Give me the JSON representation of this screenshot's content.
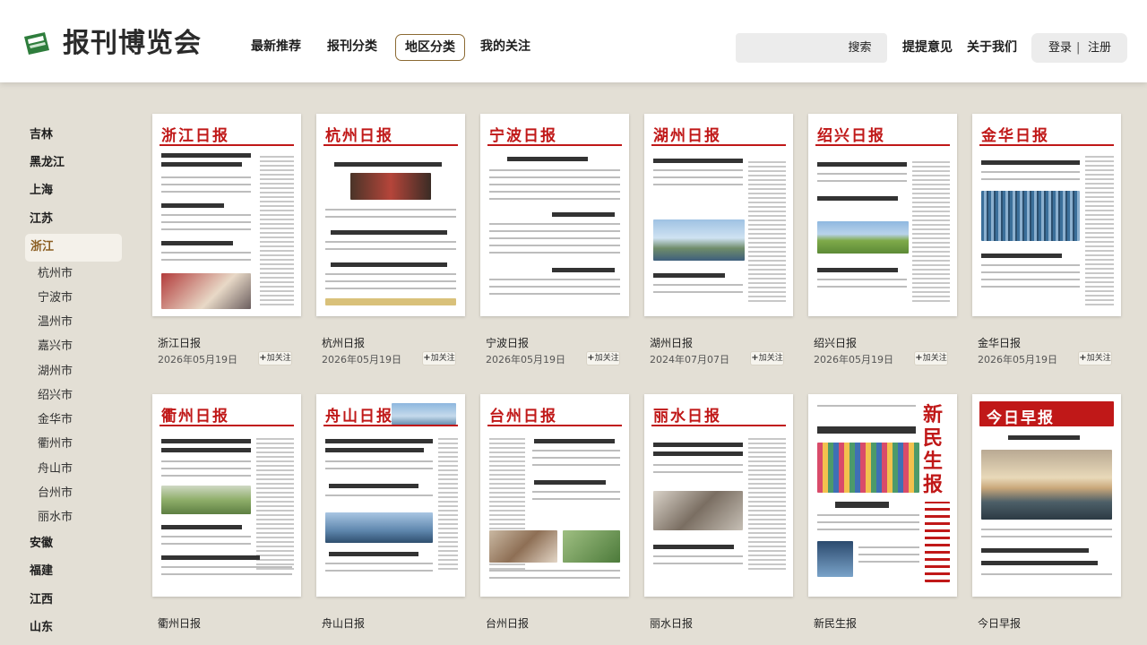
{
  "header": {
    "logo_text": "报刊博览会",
    "nav": [
      "最新推荐",
      "报刊分类",
      "地区分类",
      "我的关注"
    ],
    "search_placeholder": "",
    "search_label": "搜索",
    "feedback_label": "提提意见",
    "about_label": "关于我们",
    "login_label": "登录",
    "auth_separator": "|",
    "register_label": "注册",
    "colors": {
      "accent": "#8b6a33",
      "logo_green": "#2e7d3c",
      "masthead_red": "#c01818"
    }
  },
  "sidebar": {
    "provinces_top": [
      "吉林",
      "黑龙江",
      "上海",
      "江苏"
    ],
    "active_province": "浙江",
    "cities": [
      "杭州市",
      "宁波市",
      "温州市",
      "嘉兴市",
      "湖州市",
      "绍兴市",
      "金华市",
      "衢州市",
      "舟山市",
      "台州市",
      "丽水市"
    ],
    "provinces_bottom": [
      "安徽",
      "福建",
      "江西",
      "山东"
    ]
  },
  "follow_label": "加关注",
  "papers": [
    {
      "masthead": "浙江日报",
      "name": "浙江日报",
      "date": "2026年05月19日"
    },
    {
      "masthead": "杭州日报",
      "name": "杭州日报",
      "date": "2026年05月19日"
    },
    {
      "masthead": "宁波日报",
      "name": "宁波日报",
      "date": "2026年05月19日"
    },
    {
      "masthead": "湖州日报",
      "name": "湖州日报",
      "date": "2024年07月07日"
    },
    {
      "masthead": "绍兴日报",
      "name": "绍兴日报",
      "date": "2026年05月19日"
    },
    {
      "masthead": "金华日报",
      "name": "金华日报",
      "date": "2026年05月19日"
    },
    {
      "masthead": "衢州日报",
      "name": "衢州日报",
      "date": ""
    },
    {
      "masthead": "舟山日报",
      "name": "舟山日报",
      "date": ""
    },
    {
      "masthead": "台州日报",
      "name": "台州日报",
      "date": ""
    },
    {
      "masthead": "丽水日报",
      "name": "丽水日报",
      "date": ""
    },
    {
      "masthead": "新民生报",
      "name": "新民生报",
      "date": ""
    },
    {
      "masthead": "今日早报",
      "name": "今日早报",
      "date": ""
    }
  ]
}
